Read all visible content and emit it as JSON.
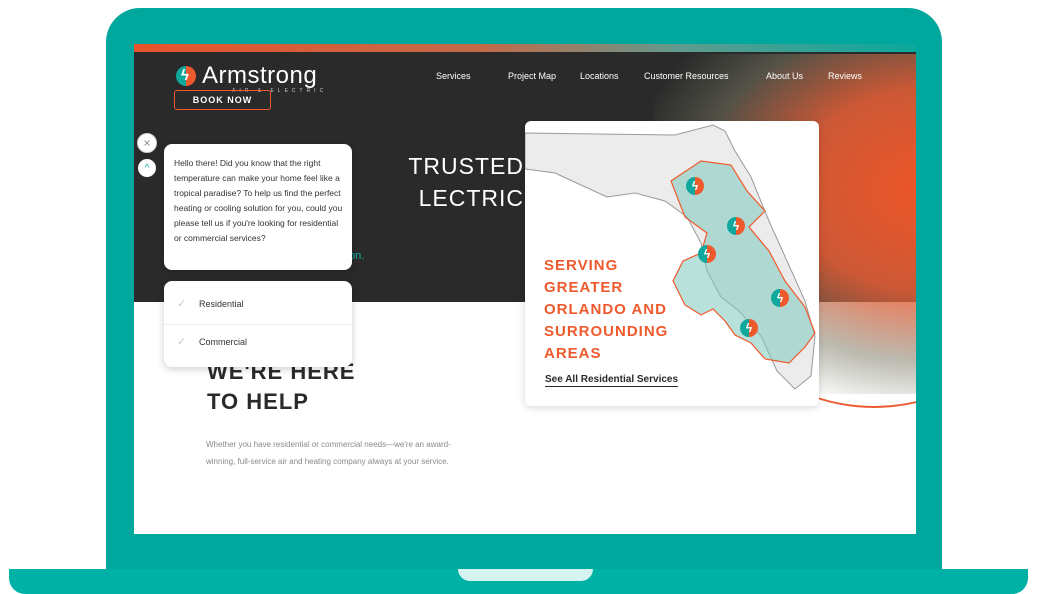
{
  "brand": {
    "name": "Armstrong",
    "tagline": "AIR & ELECTRIC",
    "book_now": "BOOK NOW"
  },
  "nav": {
    "items": [
      "Services",
      "Project Map",
      "Locations",
      "Customer Resources",
      "About Us",
      "Reviews"
    ]
  },
  "hero": {
    "title_line1": "TRUSTED",
    "title_line2": "LECTRIC",
    "subtitle": "on."
  },
  "help": {
    "title_line1": "WE'RE HERE",
    "title_line2": "TO HELP",
    "description": "Whether you have residential or commercial needs—we're an award-winning, full-service air and heating company always at your service."
  },
  "map_card": {
    "serving_line1": "SERVING",
    "serving_line2": "GREATER",
    "serving_line3": "ORLANDO AND",
    "serving_line4": "SURROUNDING",
    "serving_line5": "AREAS",
    "link_label": "See All Residential Services"
  },
  "chat": {
    "close_icon": "×",
    "collapse_icon": "^",
    "message": "Hello there! Did you know that the right temperature can make your home feel like a tropical paradise? To help us find the perfect heating or cooling solution for you, could you please tell us if you're looking for residential or commercial services?",
    "options": [
      "Residential",
      "Commercial"
    ],
    "check_icon": "✓"
  },
  "colors": {
    "accent_orange": "#ef5a2c",
    "accent_teal": "#10a89c",
    "dark_bg": "#2a2a2a",
    "laptop_frame": "#00a79d"
  }
}
